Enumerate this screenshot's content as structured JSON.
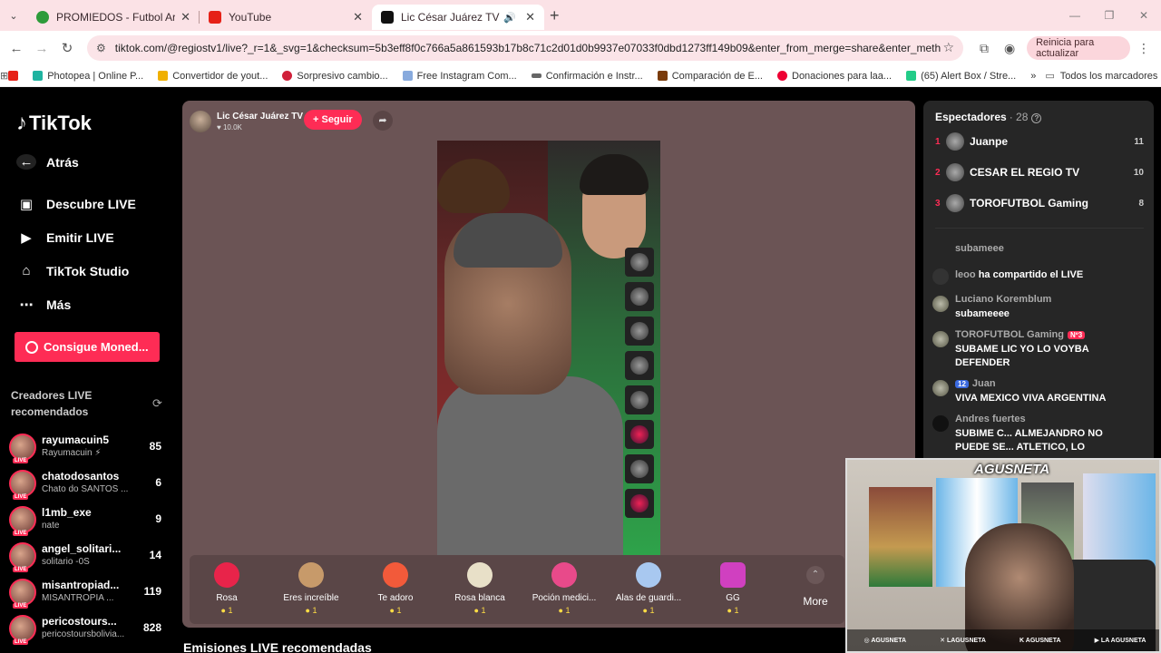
{
  "browser": {
    "tabs": [
      {
        "title": "PROMIEDOS - Futbol Argentino",
        "color": "#2d9b3a"
      },
      {
        "title": "YouTube",
        "color": "#e62117"
      },
      {
        "title": "Lic César Juárez TV (@regio",
        "color": "#111111"
      }
    ],
    "url": "tiktok.com/@regiostv1/live?_r=1&_svg=1&checksum=5b3eff8f0c766a5a861593b17b8c71c2d01d0b9937e07033f0dbd1273ff149b09&enter_from_merge=share&enter_method=share...",
    "update_label": "Reinicia para actualizar",
    "bookmarks": [
      {
        "label": "Photopea | Online P...",
        "color": "#1fb3a0"
      },
      {
        "label": "Convertidor de yout...",
        "color": "#f0b000"
      },
      {
        "label": "Sorpresivo cambio...",
        "color": "#d0203a"
      },
      {
        "label": "Free Instagram Com...",
        "color": "#8ad"
      },
      {
        "label": "Confirmación e Instr...",
        "color": "#666"
      },
      {
        "label": "Comparación de E...",
        "color": "#7a3b0a"
      },
      {
        "label": "Donaciones para laa...",
        "color": "#e03"
      },
      {
        "label": "(65) Alert Box / Stre...",
        "color": "#2c8"
      }
    ],
    "all_bookmarks": "Todos los marcadores"
  },
  "sidebar": {
    "logo": "TikTok",
    "nav": [
      {
        "label": "Atrás",
        "icon": "back-arrow-icon"
      },
      {
        "label": "Descubre LIVE",
        "icon": "live-tv-icon"
      },
      {
        "label": "Emitir LIVE",
        "icon": "video-camera-icon"
      },
      {
        "label": "TikTok Studio",
        "icon": "home-icon"
      },
      {
        "label": "Más",
        "icon": "more-dots-icon"
      }
    ],
    "coins_button": "Consigue Moned...",
    "recommended_heading": "Creadores LIVE recomendados",
    "creators": [
      {
        "name": "rayumacuin5",
        "sub": "Rayumacuin ⚡",
        "count": "85"
      },
      {
        "name": "chatodosantos",
        "sub": "Chato do SANTOS ...",
        "count": "6"
      },
      {
        "name": "l1mb_exe",
        "sub": "nate",
        "count": "9"
      },
      {
        "name": "angel_solitari...",
        "sub": "solitario -0S",
        "count": "14"
      },
      {
        "name": "misantropiad...",
        "sub": "MISANTROPIA ...",
        "count": "119"
      },
      {
        "name": "pericostours...",
        "sub": "pericostoursbolivia...",
        "count": "828"
      }
    ]
  },
  "stream": {
    "host_name": "Lic César Juárez TV",
    "host_likes": "♥ 10.0K",
    "follow_label": "+ Seguir",
    "gifts": [
      {
        "name": "Rosa",
        "price": "1",
        "color": "#e8244a"
      },
      {
        "name": "Eres increíble",
        "price": "1",
        "color": "#c79a6a"
      },
      {
        "name": "Te adoro",
        "price": "1",
        "color": "#f25a3a"
      },
      {
        "name": "Rosa blanca",
        "price": "1",
        "color": "#e8e0c8"
      },
      {
        "name": "Poción medici...",
        "price": "1",
        "color": "#e84a8a"
      },
      {
        "name": "Alas de guardi...",
        "price": "1",
        "color": "#a8c8f0"
      },
      {
        "name": "GG",
        "price": "1",
        "color": "#d040c0"
      }
    ],
    "more_label": "More",
    "bottom_heading": "Emisiones LIVE recomendadas"
  },
  "chat": {
    "spectators_label": "Espectadores",
    "spectators_count": "· 28",
    "ranking": [
      {
        "rank": "1",
        "name": "Juanpe",
        "score": "11"
      },
      {
        "rank": "2",
        "name": "CESAR EL REGIO TV",
        "score": "10"
      },
      {
        "rank": "3",
        "name": "TOROFUTBOL Gaming",
        "score": "8"
      }
    ],
    "messages": [
      {
        "user": "",
        "text": "subameee"
      },
      {
        "user": "leoo",
        "text": "ha compartido el LIVE"
      },
      {
        "user": "Luciano Koremblum",
        "text": "subameeee"
      },
      {
        "user": "TOROFUTBOL Gaming",
        "badge": "Nº3",
        "text": "SUBAME LIC YO LO VOYBA DEFENDER"
      },
      {
        "user": "Juan",
        "level": "12",
        "text": "VIVA MEXICO VIVA ARGENTINA"
      },
      {
        "user": "Andres fuertes",
        "text": "SUBIME C... ALMEJANDRO NO PUEDE SE... ATLETICO, LO"
      }
    ]
  },
  "webcam": {
    "watermark": "AGUSNETA",
    "socials": [
      "AGUSNETA",
      "LAGUSNETA",
      "AGUSNETA",
      "LA AGUSNETA"
    ]
  }
}
